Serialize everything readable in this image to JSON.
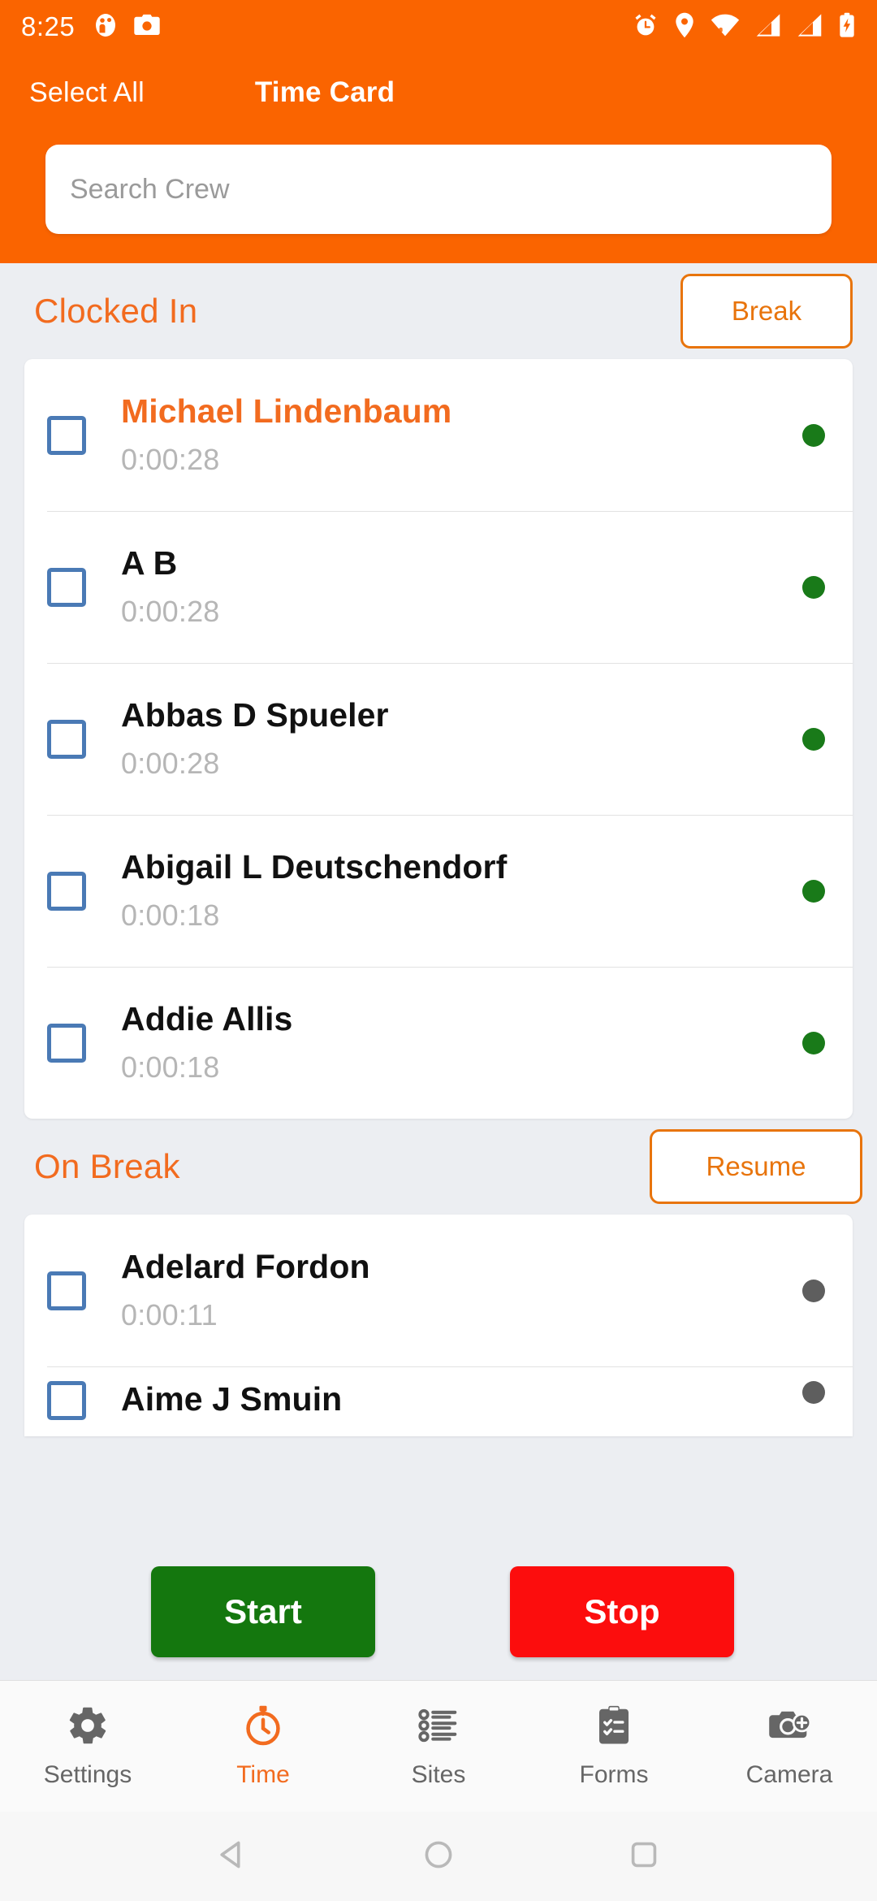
{
  "statusbar": {
    "time": "8:25",
    "left_icons": [
      "profile-icon",
      "camera-icon"
    ],
    "right_icons": [
      "alarm-icon",
      "location-icon",
      "wifi-icon",
      "signal-1-icon",
      "signal-2-icon",
      "battery-charging-icon"
    ]
  },
  "header": {
    "select_all_label": "Select All",
    "title": "Time Card",
    "search_placeholder": "Search Crew",
    "search_value": ""
  },
  "sections": [
    {
      "title": "Clocked In",
      "action_label": "Break",
      "rows": [
        {
          "name": "Michael Lindenbaum",
          "elapsed": "0:00:28",
          "status": "green",
          "highlighted": true,
          "checked": false
        },
        {
          "name": "A B",
          "elapsed": "0:00:28",
          "status": "green",
          "highlighted": false,
          "checked": false
        },
        {
          "name": "Abbas D Spueler",
          "elapsed": "0:00:28",
          "status": "green",
          "highlighted": false,
          "checked": false
        },
        {
          "name": "Abigail L Deutschendorf",
          "elapsed": "0:00:18",
          "status": "green",
          "highlighted": false,
          "checked": false
        },
        {
          "name": "Addie Allis",
          "elapsed": "0:00:18",
          "status": "green",
          "highlighted": false,
          "checked": false
        }
      ]
    },
    {
      "title": "On Break",
      "action_label": "Resume",
      "rows": [
        {
          "name": "Adelard Fordon",
          "elapsed": "0:00:11",
          "status": "gray",
          "highlighted": false,
          "checked": false
        },
        {
          "name": "Aime J Smuin",
          "elapsed": "",
          "status": "gray",
          "highlighted": false,
          "checked": false,
          "clipped": true
        }
      ]
    }
  ],
  "actions": {
    "start_label": "Start",
    "stop_label": "Stop"
  },
  "bottomnav": {
    "items": [
      {
        "label": "Settings",
        "icon": "gear-icon",
        "active": false
      },
      {
        "label": "Time",
        "icon": "stopwatch-icon",
        "active": true
      },
      {
        "label": "Sites",
        "icon": "list-icon",
        "active": false
      },
      {
        "label": "Forms",
        "icon": "clipboard-check-icon",
        "active": false
      },
      {
        "label": "Camera",
        "icon": "camera-add-icon",
        "active": false
      }
    ]
  },
  "androidnav": {
    "back": "back-triangle-icon",
    "home": "home-circle-icon",
    "recents": "recents-square-icon"
  },
  "colors": {
    "brand_orange": "#FA6400",
    "accent_orange": "#F26B1F",
    "start_green": "#14770E",
    "stop_red": "#FC0D0D",
    "status_green": "#197A19",
    "status_gray": "#5E5E5E",
    "checkbox_blue": "#4A7AB5",
    "page_background": "#ECEEF2"
  }
}
